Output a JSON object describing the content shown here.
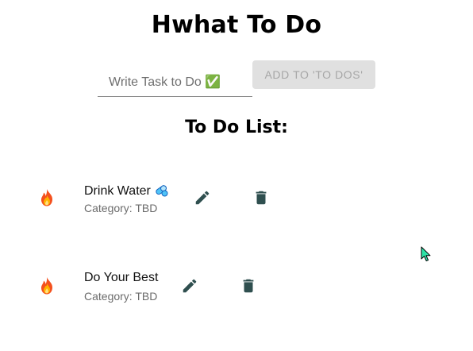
{
  "app": {
    "title": "Hwhat To Do"
  },
  "input": {
    "placeholder": "Write Task to Do ✅",
    "value": ""
  },
  "add_button": {
    "label": "ADD TO 'TO DOS'",
    "state": "disabled"
  },
  "list": {
    "heading": "To Do List:",
    "category_label": "Category:",
    "items": [
      {
        "text": "Drink Water",
        "category": "TBD",
        "priority_icon": "fire-icon",
        "extra_icon": "pill-icon"
      },
      {
        "text": "Do Your Best",
        "category": "TBD",
        "priority_icon": "fire-icon",
        "extra_icon": ""
      }
    ]
  },
  "icons": {
    "edit": "pencil-icon",
    "delete": "trash-icon"
  },
  "colors": {
    "icon_color": "#2f4f4f",
    "button_disabled_bg": "#e0e0e0",
    "button_disabled_text": "#a6a6a6",
    "cursor_fill": "#2ee3a7"
  }
}
